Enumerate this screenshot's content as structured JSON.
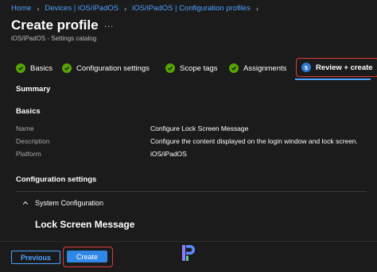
{
  "breadcrumb": [
    "Home",
    "Devices | iOS/iPadOS",
    "iOS/iPadOS | Configuration profiles"
  ],
  "header": {
    "title": "Create profile",
    "more": "...",
    "subtitle": "iOS/iPadOS - Settings catalog"
  },
  "tabs": [
    {
      "label": "Basics",
      "state": "complete"
    },
    {
      "label": "Configuration settings",
      "state": "complete"
    },
    {
      "label": "Scope tags",
      "state": "complete"
    },
    {
      "label": "Assignments",
      "state": "complete"
    },
    {
      "label": "Review + create",
      "state": "active",
      "number": "5"
    }
  ],
  "summary": {
    "heading": "Summary",
    "basics_heading": "Basics",
    "rows": [
      {
        "label": "Name",
        "value": "Configure Lock Screen Message"
      },
      {
        "label": "Description",
        "value": "Configure the content displayed on the login window and lock screen."
      },
      {
        "label": "Platform",
        "value": "iOS/iPadOS"
      }
    ],
    "config_heading": "Configuration settings",
    "system_config": "System Configuration",
    "setting": "Lock Screen Message"
  },
  "footer": {
    "previous_label": "Previous",
    "create_label": "Create"
  },
  "colors": {
    "background": "#1b1b1b",
    "link": "#4ea2ff",
    "success": "#57a300",
    "primary": "#2f88e6",
    "highlight": "#e03b3b"
  }
}
